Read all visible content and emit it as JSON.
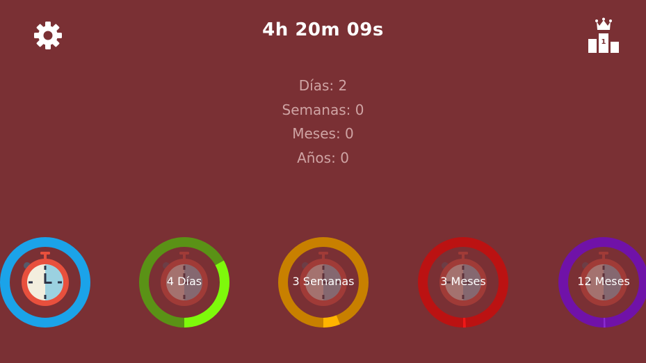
{
  "header": {
    "elapsed": "4h 20m 09s",
    "settings_icon": "gear-icon",
    "ranking_icon": "podium-icon"
  },
  "stats": [
    {
      "label": "Días: 2"
    },
    {
      "label": "Semanas: 0"
    },
    {
      "label": "Meses: 0"
    },
    {
      "label": "Años: 0"
    }
  ],
  "goals": [
    {
      "label": "",
      "icon": "stopwatch-icon",
      "ring_color": "#1ba3e9",
      "progress_color": "#1ba3e9",
      "progress": 1.0
    },
    {
      "label": "4 Días",
      "icon": "stopwatch-icon",
      "ring_color": "#5a9216",
      "progress_color": "#7ef90b",
      "progress": 0.33
    },
    {
      "label": "3 Semanas",
      "icon": "stopwatch-icon",
      "ring_color": "#c88000",
      "progress_color": "#ffb400",
      "progress": 0.06
    },
    {
      "label": "3 Meses",
      "icon": "stopwatch-icon",
      "ring_color": "#bb1212",
      "progress_color": "#f01818",
      "progress": 0.01
    },
    {
      "label": "12 Meses",
      "icon": "stopwatch-icon",
      "ring_color": "#7012a8",
      "progress_color": "#8a2bd0",
      "progress": 0.004
    }
  ]
}
